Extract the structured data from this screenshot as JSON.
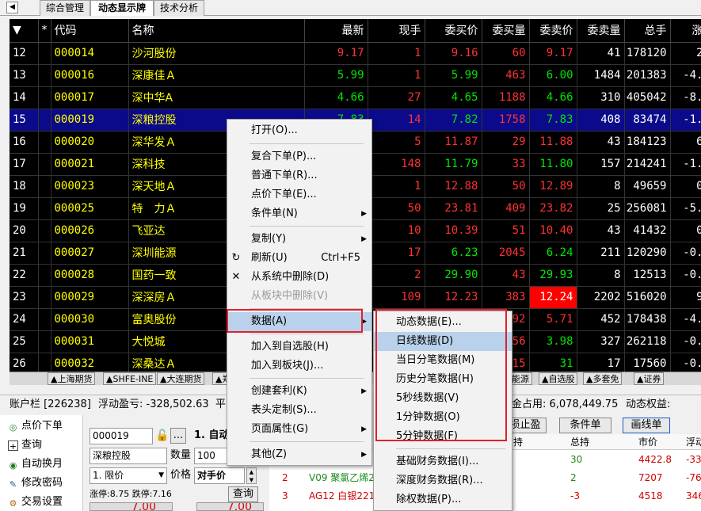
{
  "tabs": [
    "综合管理",
    "动态显示牌",
    "技术分析"
  ],
  "grid": {
    "headers": [
      "▼",
      "*",
      "代码",
      "名称",
      "最新",
      "现手",
      "委买价",
      "委买量",
      "委卖价",
      "委卖量",
      "总手",
      "涨"
    ],
    "rows": [
      {
        "idx": "12",
        "code": "000014",
        "name": "沙河股份",
        "last": "9.17",
        "vol": "1",
        "bid": "9.16",
        "bidv": "60",
        "ask": "9.17",
        "askv": "41",
        "total": "178120",
        "chg": "2"
      },
      {
        "idx": "13",
        "code": "000016",
        "name": "深康佳Ａ",
        "last": "5.99",
        "vol": "1",
        "bid": "5.99",
        "bidv": "463",
        "ask": "6.00",
        "askv": "1484",
        "total": "201383",
        "chg": "-4."
      },
      {
        "idx": "14",
        "code": "000017",
        "name": "深中华A",
        "last": "4.66",
        "vol": "27",
        "bid": "4.65",
        "bidv": "1188",
        "ask": "4.66",
        "askv": "310",
        "total": "405042",
        "chg": "-8."
      },
      {
        "idx": "15",
        "code": "000019",
        "name": "深粮控股",
        "last": "7.83",
        "vol": "14",
        "bid": "7.82",
        "bidv": "1758",
        "ask": "7.83",
        "askv": "408",
        "total": "83474",
        "chg": "-1."
      },
      {
        "idx": "16",
        "code": "000020",
        "name": "深华发Ａ",
        "last": "",
        "vol": "5",
        "bid": "11.87",
        "bidv": "29",
        "ask": "11.88",
        "askv": "43",
        "total": "184123",
        "chg": "6"
      },
      {
        "idx": "17",
        "code": "000021",
        "name": "深科技",
        "last": "",
        "vol": "148",
        "bid": "11.79",
        "bidv": "33",
        "ask": "11.80",
        "askv": "157",
        "total": "214241",
        "chg": "-1."
      },
      {
        "idx": "18",
        "code": "000023",
        "name": "深天地Ａ",
        "last": "",
        "vol": "1",
        "bid": "12.88",
        "bidv": "50",
        "ask": "12.89",
        "askv": "8",
        "total": "49659",
        "chg": "0"
      },
      {
        "idx": "19",
        "code": "000025",
        "name": "特　力Ａ",
        "last": "",
        "vol": "50",
        "bid": "23.81",
        "bidv": "409",
        "ask": "23.82",
        "askv": "25",
        "total": "256081",
        "chg": "-5."
      },
      {
        "idx": "20",
        "code": "000026",
        "name": "飞亚达",
        "last": "",
        "vol": "10",
        "bid": "10.39",
        "bidv": "51",
        "ask": "10.40",
        "askv": "43",
        "total": "41432",
        "chg": "0"
      },
      {
        "idx": "21",
        "code": "000027",
        "name": "深圳能源",
        "last": "",
        "vol": "17",
        "bid": "6.23",
        "bidv": "2045",
        "ask": "6.24",
        "askv": "211",
        "total": "120290",
        "chg": "-0."
      },
      {
        "idx": "22",
        "code": "000028",
        "name": "国药一致",
        "last": "",
        "vol": "2",
        "bid": "29.90",
        "bidv": "43",
        "ask": "29.93",
        "askv": "8",
        "total": "12513",
        "chg": "-0."
      },
      {
        "idx": "23",
        "code": "000029",
        "name": "深深房Ａ",
        "last": "",
        "vol": "109",
        "bid": "12.23",
        "bidv": "383",
        "ask": "12.24",
        "askv": "2202",
        "total": "516020",
        "chg": "9"
      },
      {
        "idx": "24",
        "code": "000030",
        "name": "富奥股份",
        "last": "",
        "vol": "",
        "bid": "",
        "bidv": "492",
        "ask": "5.71",
        "askv": "452",
        "total": "178438",
        "chg": "-4."
      },
      {
        "idx": "25",
        "code": "000031",
        "name": "大悦城",
        "last": "",
        "vol": "",
        "bid": "",
        "bidv": "56",
        "ask": "3.98",
        "askv": "327",
        "total": "262118",
        "chg": "-0."
      },
      {
        "idx": "26",
        "code": "000032",
        "name": "深桑达Ａ",
        "last": "",
        "vol": "",
        "bid": "",
        "bidv": "15",
        "ask": "31",
        "askv": "17",
        "total": "17560",
        "chg": "-0."
      }
    ]
  },
  "sheet_tabs": [
    "▲上海期货",
    "▲SHFE-INE",
    "▲大连期货",
    "▲郑",
    "能源",
    "▲自选股",
    "▲多套免",
    "▲证券"
  ],
  "account_bar": {
    "account": "账户栏 [226238]",
    "float_pl": "浮动盈亏: -328,502.63",
    "ping": "平",
    "margin": "金占用: 6,078,449.75",
    "equity": "动态权益: 12,54"
  },
  "left_nav": [
    "点价下单",
    "查询",
    "自动换月",
    "修改密码",
    "交易设置"
  ],
  "order_form": {
    "code": "000019",
    "name": "深粮控股",
    "mode": "1. 自动",
    "qty_label": "数量",
    "qty": "100",
    "price_type": "1. 限价",
    "price_label": "价格",
    "price": "对手价",
    "limits": "涨停:8.75 跌停:7.16",
    "query": "查询",
    "dots": "...",
    "partial_left": "7.00",
    "partial_right": "7.00"
  },
  "right_buttons": [
    "损止盈",
    "条件单",
    "画线单"
  ],
  "positions": {
    "headers": [
      "持",
      "总持",
      "市价",
      "浮动"
    ],
    "rows": [
      {
        "n": "",
        "name": "",
        "hold": "30",
        "price": "4422.8",
        "pl": "-33"
      },
      {
        "n": "2",
        "name": "V09 聚氯乙烯2",
        "hold": "2",
        "price": "7207",
        "pl": "-76"
      },
      {
        "n": "3",
        "name": "AG12 白银221",
        "hold": "-3",
        "price": "4518",
        "pl": "346"
      }
    ]
  },
  "context_menu": {
    "items": [
      "打开(O)...",
      "复合下单(P)...",
      "普通下单(R)...",
      "点价下单(E)...",
      "条件单(N)",
      "复制(Y)",
      "刷新(U)",
      "从系统中删除(D)",
      "从板块中删除(V)",
      "数据(A)",
      "加入到自选股(H)",
      "加入到板块(J)...",
      "创建套利(K)",
      "表头定制(S)...",
      "页面属性(G)",
      "其他(Z)"
    ],
    "refresh_shortcut": "Ctrl+F5"
  },
  "submenu": {
    "items": [
      "动态数据(E)...",
      "日线数据(D)",
      "当日分笔数据(M)",
      "历史分笔数据(H)",
      "5秒线数据(V)",
      "1分钟数据(O)",
      "5分钟数据(F)",
      "基础财务数据(I)...",
      "深度财务数据(R)...",
      "除权数据(P)..."
    ]
  },
  "colors": {
    "up": "#ff3232",
    "down": "#00e600",
    "selected_row": "#0a0a8a",
    "highlight_box": "#e0202a"
  }
}
